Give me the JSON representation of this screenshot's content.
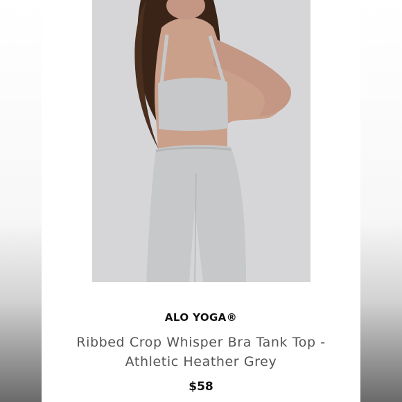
{
  "product": {
    "brand": "ALO YOGA®",
    "title": "Ribbed Crop Whisper Bra Tank Top - Athletic Heather Grey",
    "price": "$58",
    "image_icon": "product-photo"
  },
  "colors": {
    "page_background": "#ffffff",
    "photo_background": "#d6d6d8",
    "garment": "#c6c8ca",
    "skin": "#caa08a",
    "hair": "#3a2418"
  }
}
